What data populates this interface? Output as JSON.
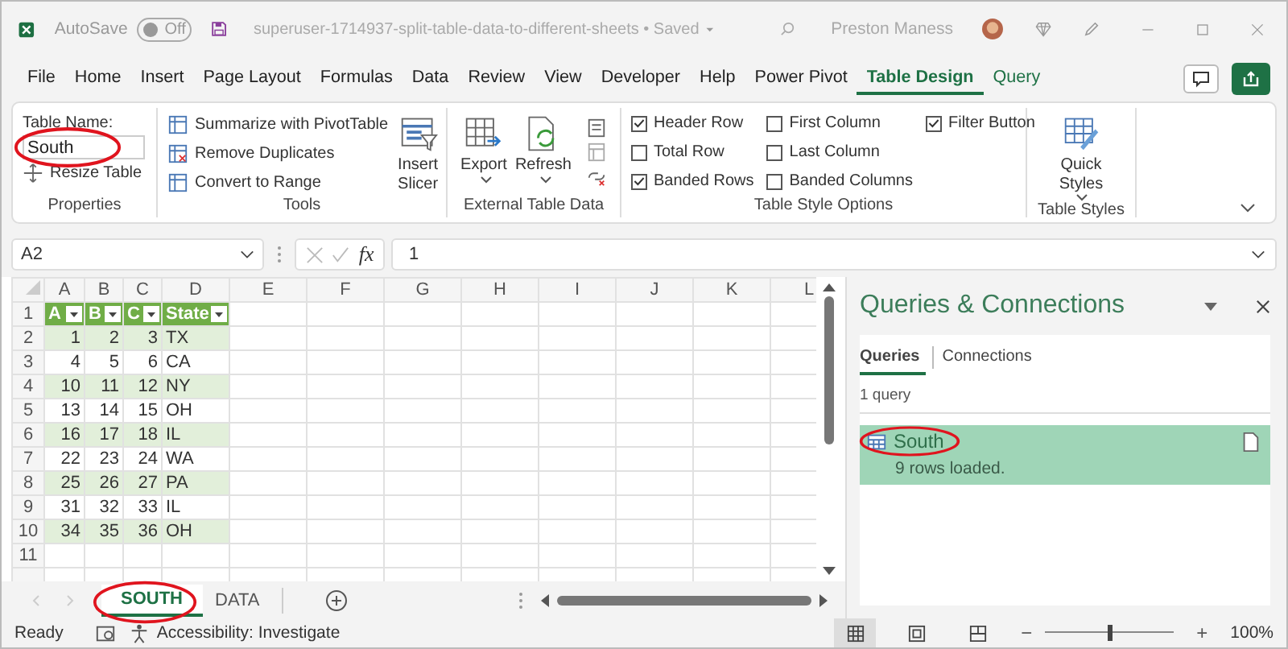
{
  "title_bar": {
    "autosave_label": "AutoSave",
    "autosave_toggle": {
      "label": "Off",
      "on": false
    },
    "document_title": "superuser-1714937-split-table-data-to-different-sheets • Saved",
    "user_name": "Preston Maness"
  },
  "menu_tabs": [
    {
      "label": "File",
      "selected": false,
      "contextual": false
    },
    {
      "label": "Home",
      "selected": false,
      "contextual": false
    },
    {
      "label": "Insert",
      "selected": false,
      "contextual": false
    },
    {
      "label": "Page Layout",
      "selected": false,
      "contextual": false
    },
    {
      "label": "Formulas",
      "selected": false,
      "contextual": false
    },
    {
      "label": "Data",
      "selected": false,
      "contextual": false
    },
    {
      "label": "Review",
      "selected": false,
      "contextual": false
    },
    {
      "label": "View",
      "selected": false,
      "contextual": false
    },
    {
      "label": "Developer",
      "selected": false,
      "contextual": false
    },
    {
      "label": "Help",
      "selected": false,
      "contextual": false
    },
    {
      "label": "Power Pivot",
      "selected": false,
      "contextual": false
    },
    {
      "label": "Table Design",
      "selected": true,
      "contextual": true
    },
    {
      "label": "Query",
      "selected": false,
      "contextual": true
    }
  ],
  "ribbon": {
    "properties": {
      "label": "Properties",
      "table_name_label": "Table Name:",
      "table_name": "South",
      "circled": true,
      "resize_button": "Resize Table"
    },
    "tools": {
      "label": "Tools",
      "buttons": [
        "Summarize with PivotTable",
        "Remove Duplicates",
        "Convert to Range"
      ],
      "slicer_button": "Insert Slicer"
    },
    "external_table_data": {
      "label": "External Table Data",
      "export_button": "Export",
      "refresh_button": "Refresh"
    },
    "style_options": {
      "label": "Table Style Options",
      "options": [
        {
          "label": "Header Row",
          "checked": true
        },
        {
          "label": "Total Row",
          "checked": false
        },
        {
          "label": "Banded Rows",
          "checked": true
        },
        {
          "label": "First Column",
          "checked": false
        },
        {
          "label": "Last Column",
          "checked": false
        },
        {
          "label": "Banded Columns",
          "checked": false
        },
        {
          "label": "Filter Button",
          "checked": true
        }
      ]
    },
    "table_styles": {
      "label": "Table Styles",
      "quick_styles_button": "Quick Styles"
    }
  },
  "formula_bar": {
    "name_box": "A2",
    "fx": "fx",
    "formula": "1"
  },
  "sheet": {
    "columns": [
      "A",
      "B",
      "C",
      "D",
      "E",
      "F",
      "G",
      "H",
      "I",
      "J",
      "K",
      "L"
    ],
    "row_numbers": [
      "1",
      "2",
      "3",
      "4",
      "5",
      "6",
      "7",
      "8",
      "9",
      "10",
      "11"
    ],
    "table": {
      "headers": [
        "A",
        "B",
        "C",
        "State"
      ],
      "rows": [
        [
          "1",
          "2",
          "3",
          "TX"
        ],
        [
          "4",
          "5",
          "6",
          "CA"
        ],
        [
          "10",
          "11",
          "12",
          "NY"
        ],
        [
          "13",
          "14",
          "15",
          "OH"
        ],
        [
          "16",
          "17",
          "18",
          "IL"
        ],
        [
          "22",
          "23",
          "24",
          "WA"
        ],
        [
          "25",
          "26",
          "27",
          "PA"
        ],
        [
          "31",
          "32",
          "33",
          "IL"
        ],
        [
          "34",
          "35",
          "36",
          "OH"
        ]
      ]
    }
  },
  "sheet_tabs": [
    {
      "label": "SOUTH",
      "selected": true,
      "circled": true
    },
    {
      "label": "DATA",
      "selected": false,
      "circled": false
    }
  ],
  "queries_pane": {
    "title": "Queries & Connections",
    "tabs": [
      {
        "label": "Queries",
        "selected": true
      },
      {
        "label": "Connections",
        "selected": false
      }
    ],
    "count": "1 query",
    "queries": [
      {
        "name": "South",
        "status": "9 rows loaded.",
        "selected": true,
        "circled": true
      }
    ]
  },
  "status_bar": {
    "status": "Ready",
    "accessibility": "Accessibility: Investigate",
    "zoom_out": "−",
    "zoom_in": "+",
    "zoom": {
      "level": 0.5
    },
    "zoom_reading": "100%"
  }
}
